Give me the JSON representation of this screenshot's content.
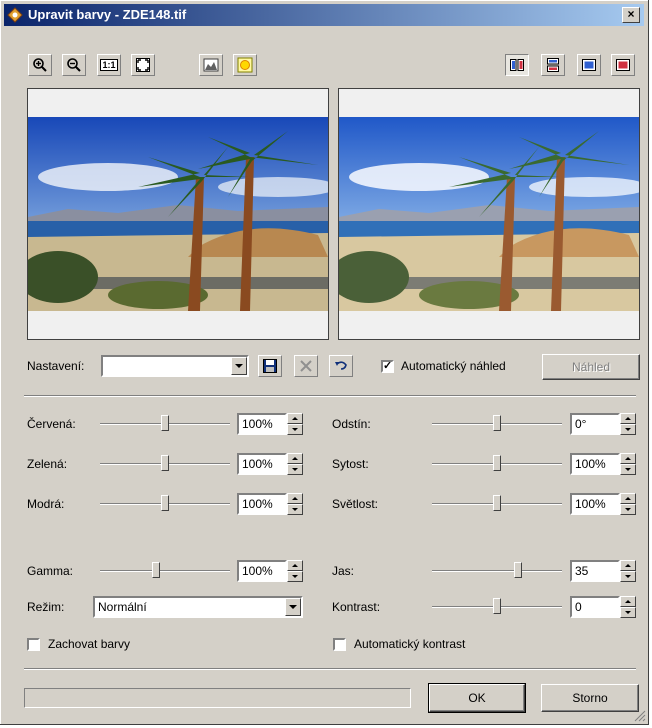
{
  "window": {
    "title": "Upravit barvy - ZDE148.tif",
    "close_label": "×"
  },
  "toolbar": {
    "zoom_in_icon": "zoom-in-icon",
    "zoom_out_icon": "zoom-out-icon",
    "actual_size_label": "1:1",
    "fit_icon": "fit-to-window-icon",
    "histogram_icon": "histogram-icon",
    "auto_color_icon": "sun-icon",
    "view_side_by_side_icon": "side-by-side-view-icon",
    "view_top_bottom_icon": "top-bottom-view-icon",
    "view_single_icon": "single-view-icon",
    "view_original_icon": "original-view-icon"
  },
  "preset": {
    "label": "Nastavení:",
    "value": "",
    "save_icon": "save-icon",
    "delete_icon": "delete-icon",
    "undo_icon": "undo-icon"
  },
  "auto_preview": {
    "label": "Automatický náhled",
    "checked": true
  },
  "preview_button": "Náhled",
  "left_sliders": [
    {
      "label": "Červená:",
      "value": "100%",
      "level": 0.5
    },
    {
      "label": "Zelená:",
      "value": "100%",
      "level": 0.5
    },
    {
      "label": "Modrá:",
      "value": "100%",
      "level": 0.5
    }
  ],
  "right_sliders": [
    {
      "label": "Odstín:",
      "value": "0°",
      "level": 0.5
    },
    {
      "label": "Sytost:",
      "value": "100%",
      "level": 0.5
    },
    {
      "label": "Světlost:",
      "value": "100%",
      "level": 0.5
    }
  ],
  "gamma": {
    "label": "Gamma:",
    "value": "100%",
    "level": 0.43
  },
  "brightness": {
    "label": "Jas:",
    "value": "35",
    "level": 0.67
  },
  "mode": {
    "label": "Režim:",
    "value": "Normální"
  },
  "contrast": {
    "label": "Kontrast:",
    "value": "0",
    "level": 0.5
  },
  "keep_colors": {
    "label": "Zachovat barvy",
    "checked": false
  },
  "auto_contrast": {
    "label": "Automatický kontrast",
    "checked": false
  },
  "buttons": {
    "ok": "OK",
    "cancel": "Storno"
  },
  "progress": 0
}
